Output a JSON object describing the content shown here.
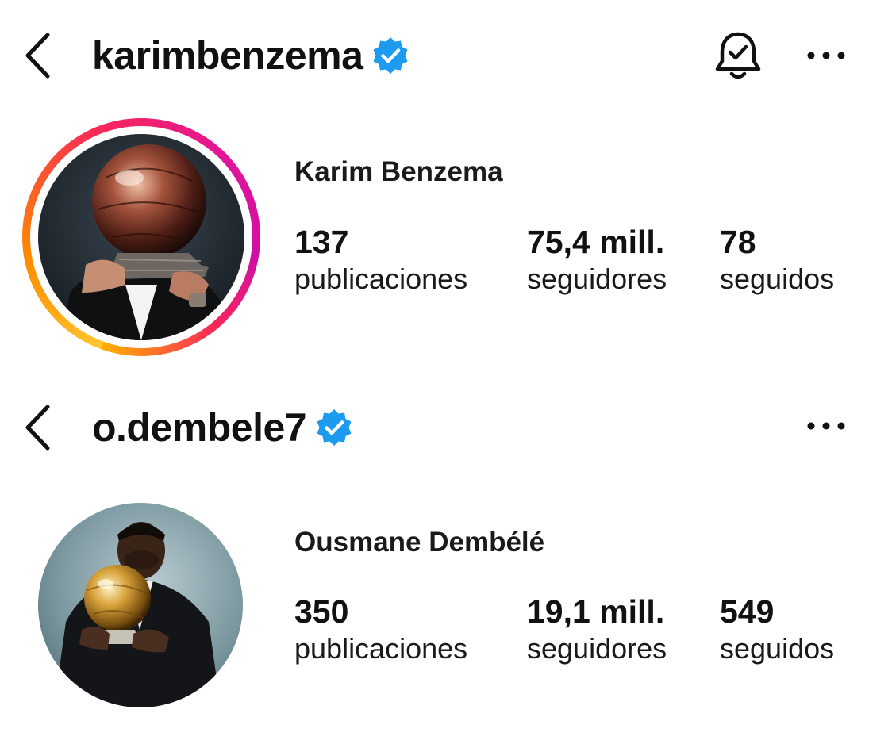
{
  "profiles": [
    {
      "username": "karimbenzema",
      "verified": true,
      "display_name": "Karim Benzema",
      "has_story_ring": true,
      "has_notification_bell": true,
      "stats": [
        {
          "value": "137",
          "label": "publicaciones"
        },
        {
          "value": "75,4 mill.",
          "label": "seguidores"
        },
        {
          "value": "78",
          "label": "seguidos"
        }
      ]
    },
    {
      "username": "o.dembele7",
      "verified": true,
      "display_name": "Ousmane Dembélé",
      "has_story_ring": false,
      "has_notification_bell": false,
      "stats": [
        {
          "value": "350",
          "label": "publicaciones"
        },
        {
          "value": "19,1 mill.",
          "label": "seguidores"
        },
        {
          "value": "549",
          "label": "seguidos"
        }
      ]
    }
  ],
  "icons": {
    "back": "chevron-left-icon",
    "verified": "verified-badge-icon",
    "bell": "bell-check-icon",
    "more": "more-horizontal-icon"
  },
  "colors": {
    "verified_blue": "#1d9bf0",
    "text": "#111111",
    "background": "#ffffff"
  }
}
